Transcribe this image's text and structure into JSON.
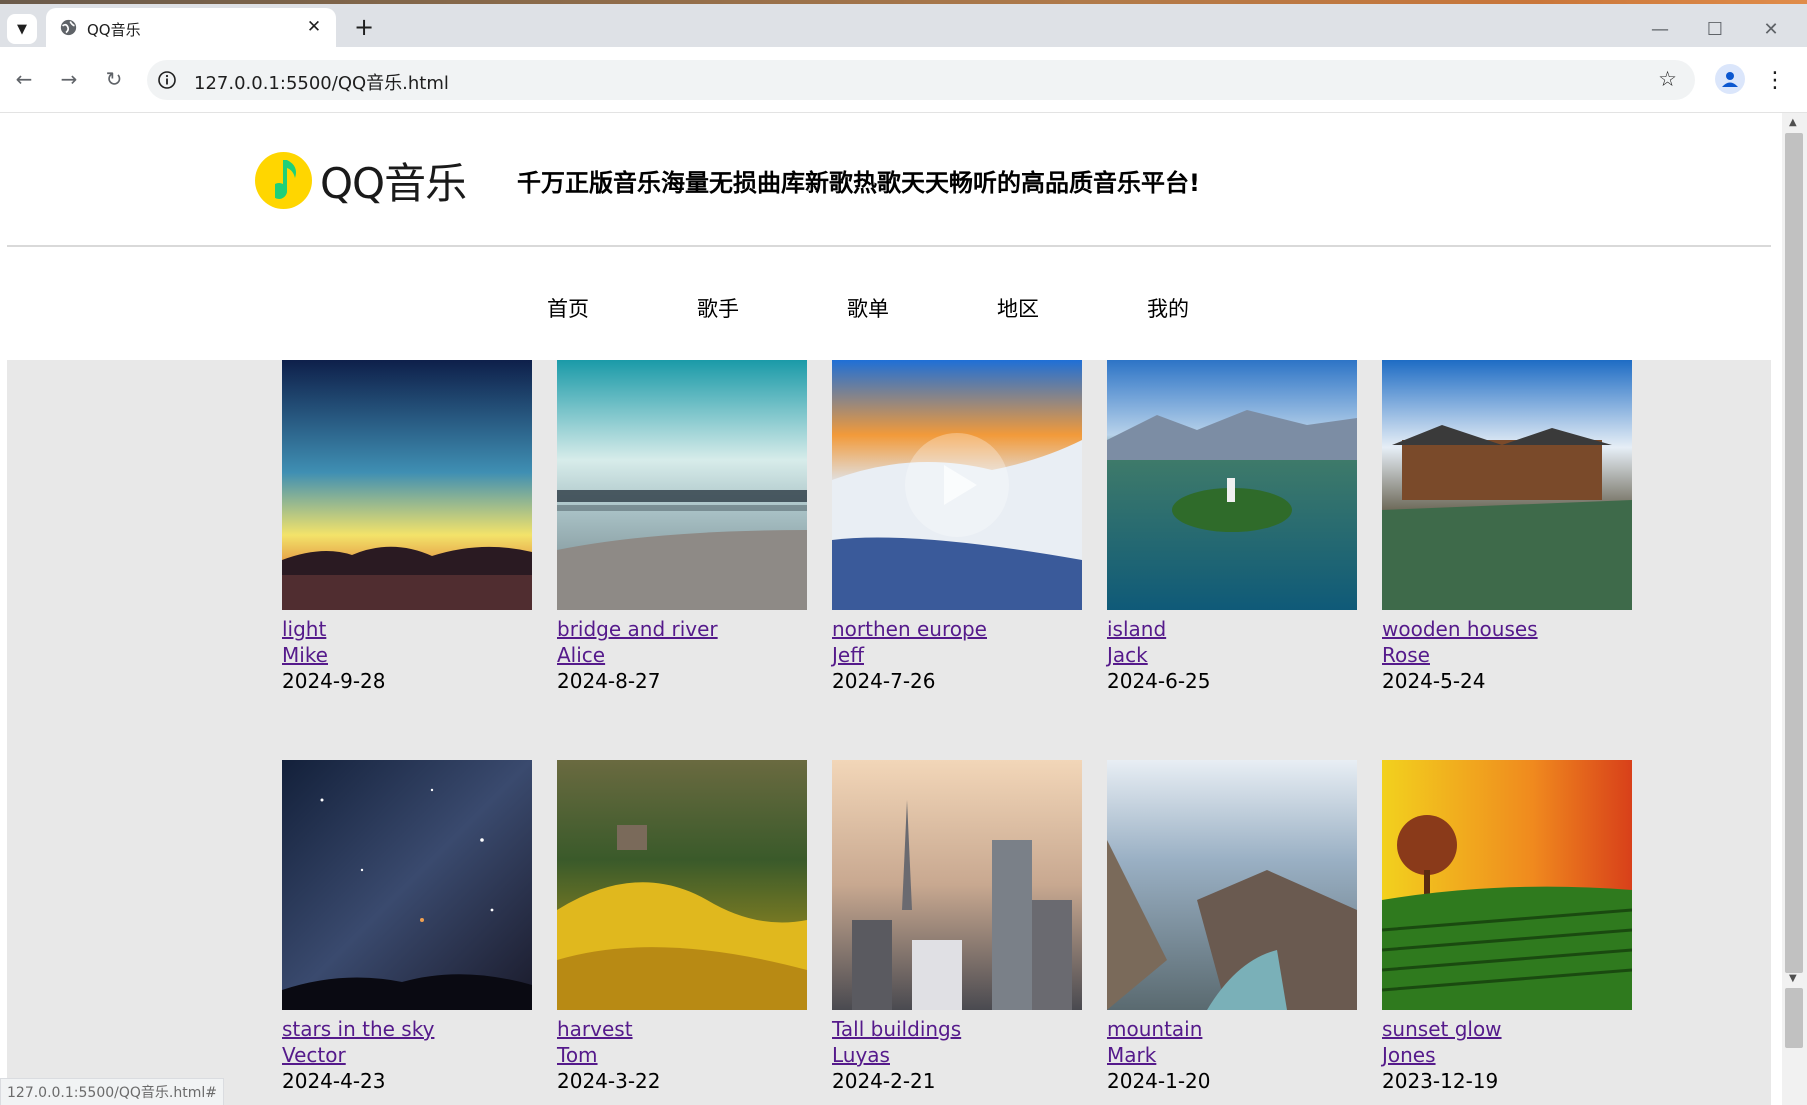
{
  "browser": {
    "tab_title": "QQ音乐",
    "url": "127.0.0.1:5500/QQ音乐.html",
    "status_url": "127.0.0.1:5500/QQ音乐.html#"
  },
  "header": {
    "logo_text": "QQ音乐",
    "slogan": "千万正版音乐海量无损曲库新歌热歌天天畅听的高品质音乐平台!"
  },
  "nav": {
    "items": [
      "首页",
      "歌手",
      "歌单",
      "地区",
      "我的"
    ]
  },
  "songs": [
    {
      "name": "light",
      "artist": "Mike",
      "date": "2024-9-28"
    },
    {
      "name": "bridge and river",
      "artist": "Alice",
      "date": "2024-8-27"
    },
    {
      "name": "northen europe",
      "artist": "Jeff",
      "date": "2024-7-26"
    },
    {
      "name": "island",
      "artist": "Jack",
      "date": "2024-6-25"
    },
    {
      "name": "wooden houses",
      "artist": "Rose",
      "date": "2024-5-24"
    },
    {
      "name": "stars in the sky",
      "artist": "Vector",
      "date": "2024-4-23"
    },
    {
      "name": "harvest",
      "artist": "Tom",
      "date": "2024-3-22"
    },
    {
      "name": "Tall buildings",
      "artist": "Luyas",
      "date": "2024-2-21"
    },
    {
      "name": "mountain",
      "artist": "Mark",
      "date": "2024-1-20"
    },
    {
      "name": "sunset glow",
      "artist": "Jones",
      "date": "2023-12-19"
    }
  ],
  "colors": {
    "link": "#551a8b",
    "content_bg": "#e8e8e8",
    "logo_yellow": "#ffd600",
    "logo_green": "#1fd078"
  }
}
